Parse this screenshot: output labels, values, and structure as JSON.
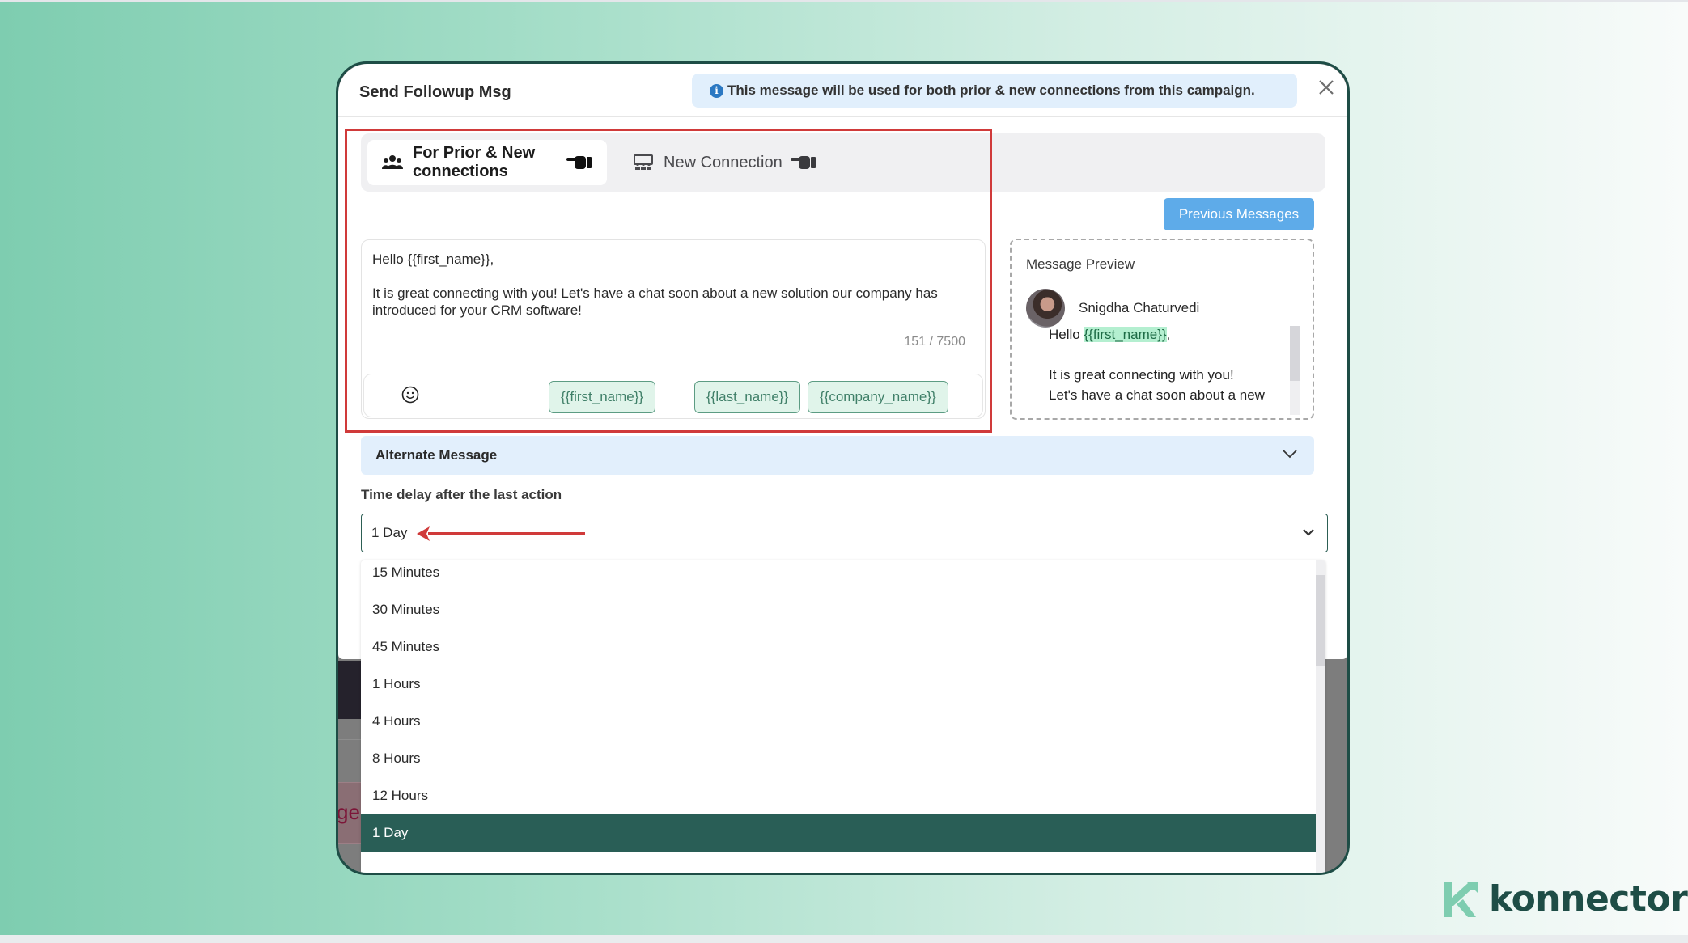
{
  "modal": {
    "title": "Send Followup Msg",
    "info_banner": "This message will be used for both prior & new connections from this campaign.",
    "close_icon": "close-icon"
  },
  "tabs": [
    {
      "label": "For Prior & New connections",
      "icon": "users-icon",
      "active": true
    },
    {
      "label": "New Connection",
      "icon": "network-icon",
      "active": false
    }
  ],
  "editor": {
    "text": "Hello {{first_name}},\n\nIt is great connecting with you! Let's have a chat soon about a new solution our company has introduced for your CRM software!",
    "char_count": "151 / 7500",
    "emoji_icon": "smiley-icon",
    "variables": [
      "{{first_name}}",
      "{{last_name}}",
      "{{company_name}}"
    ]
  },
  "previous_messages_label": "Previous Messages",
  "preview": {
    "title": "Message Preview",
    "sender_name": "Snigdha Chaturvedi",
    "greeting_prefix": "Hello ",
    "greeting_var": "{{first_name}}",
    "greeting_suffix": ",",
    "body": "It is great connecting with you!\nLet's have a chat soon about a new"
  },
  "alternate_message": {
    "label": "Alternate Message"
  },
  "time_delay": {
    "label": "Time delay after the last action",
    "value": "1 Day",
    "options": [
      "15 Minutes",
      "30 Minutes",
      "45 Minutes",
      "1 Hours",
      "4 Hours",
      "8 Hours",
      "12 Hours",
      "1 Day"
    ],
    "selected_index": 7
  },
  "background_fragment": "ge",
  "brand": {
    "name": "konnector",
    "primary": "#1e4d46",
    "accent": "#7ecdb0"
  }
}
